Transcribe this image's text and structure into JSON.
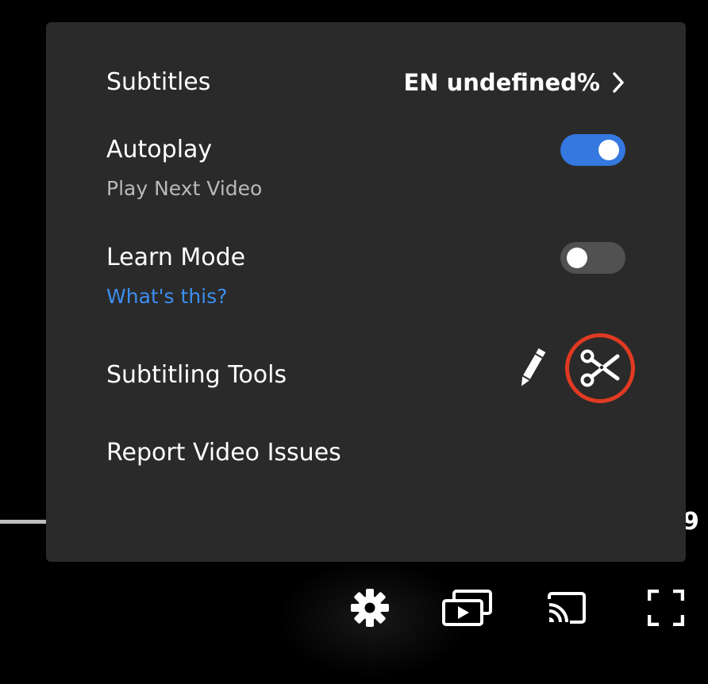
{
  "menu": {
    "subtitles": {
      "label": "Subtitles",
      "value": "EN undefined%"
    },
    "autoplay": {
      "label": "Autoplay",
      "sublabel": "Play Next Video",
      "enabled": true
    },
    "learn_mode": {
      "label": "Learn Mode",
      "link": "What's this?",
      "enabled": false
    },
    "subtitling_tools": {
      "label": "Subtitling Tools",
      "tools": [
        "pencil-icon",
        "scissors-icon"
      ]
    },
    "report": {
      "label": "Report Video Issues"
    }
  },
  "player": {
    "time_fragment": "9"
  },
  "colors": {
    "menu_bg": "#2a2a2a",
    "accent_blue": "#3478e0",
    "link_blue": "#3d8ef0",
    "highlight_red": "#e03a22",
    "toggle_off": "#515151"
  },
  "controls": [
    "gear-icon",
    "playlist-icon",
    "cast-icon",
    "fullscreen-icon"
  ]
}
